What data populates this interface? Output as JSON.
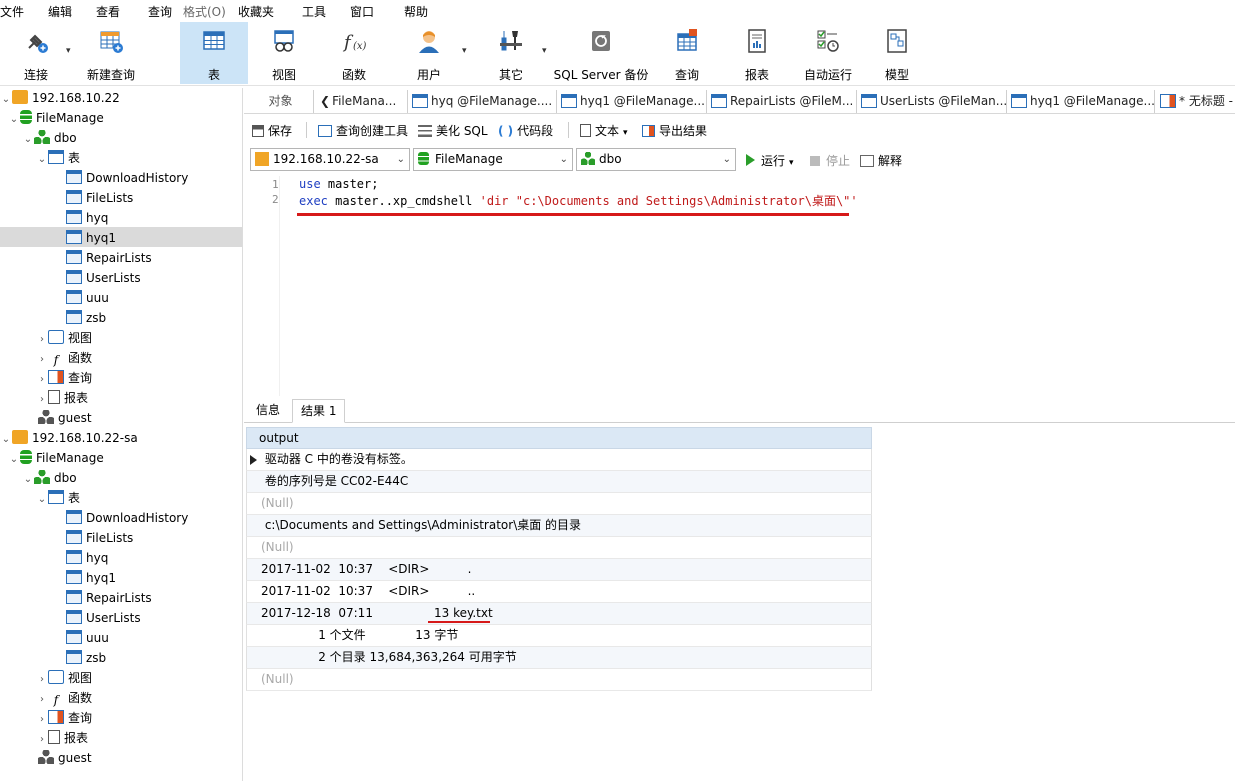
{
  "menu": [
    "文件",
    "编辑",
    "查看",
    "查询",
    "格式(O)",
    "收藏夹",
    "工具",
    "窗口",
    "帮助"
  ],
  "toolbar": [
    "连接",
    "新建查询",
    "表",
    "视图",
    "函数",
    "用户",
    "其它",
    "SQL Server 备份",
    "查询",
    "报表",
    "自动运行",
    "模型"
  ],
  "tree": {
    "conn1": "192.168.10.22",
    "db": "FileManage",
    "schema": "dbo",
    "tables_label": "表",
    "tables": [
      "DownloadHistory",
      "FileLists",
      "hyq",
      "hyq1",
      "RepairLists",
      "UserLists",
      "uuu",
      "zsb"
    ],
    "views": "视图",
    "funcs": "函数",
    "queries": "查询",
    "reports": "报表",
    "guest": "guest",
    "conn2": "192.168.10.22-sa"
  },
  "tabs": [
    "对象",
    "FileMana...",
    "hyq @FileManage....",
    "hyq1 @FileManage...",
    "RepairLists @FileM...",
    "UserLists @FileMan...",
    "hyq1 @FileManage...",
    "* 无标题 -"
  ],
  "editor_toolbar": [
    "保存",
    "查询创建工具",
    "美化 SQL",
    "代码段",
    "文本",
    "导出结果"
  ],
  "connection": {
    "server": "192.168.10.22-sa",
    "database": "FileManage",
    "schema": "dbo",
    "run": "运行",
    "stop": "停止",
    "explain": "解释"
  },
  "code": {
    "line1_num": "1",
    "line2_num": "2",
    "line1_kw": "use",
    "line1_rest": " master;",
    "line2_kw": "exec",
    "line2_mid": " master..xp_cmdshell ",
    "line2_str": "'dir \"c:\\Documents and Settings\\Administrator\\桌面\\\"'"
  },
  "result_tabs": [
    "信息",
    "结果 1"
  ],
  "grid": {
    "header": "output",
    "rows": [
      " 驱动器 C 中的卷没有标签。",
      " 卷的序列号是 CC02-E44C",
      "(Null)",
      " c:\\Documents and Settings\\Administrator\\桌面 的目录",
      "(Null)",
      "2017-11-02  10:37    <DIR>          .",
      "2017-11-02  10:37    <DIR>          ..",
      "2017-12-18  07:11                13 key.txt",
      "               1 个文件             13 字节",
      "               2 个目录 13,684,363,264 可用字节",
      "(Null)"
    ]
  }
}
